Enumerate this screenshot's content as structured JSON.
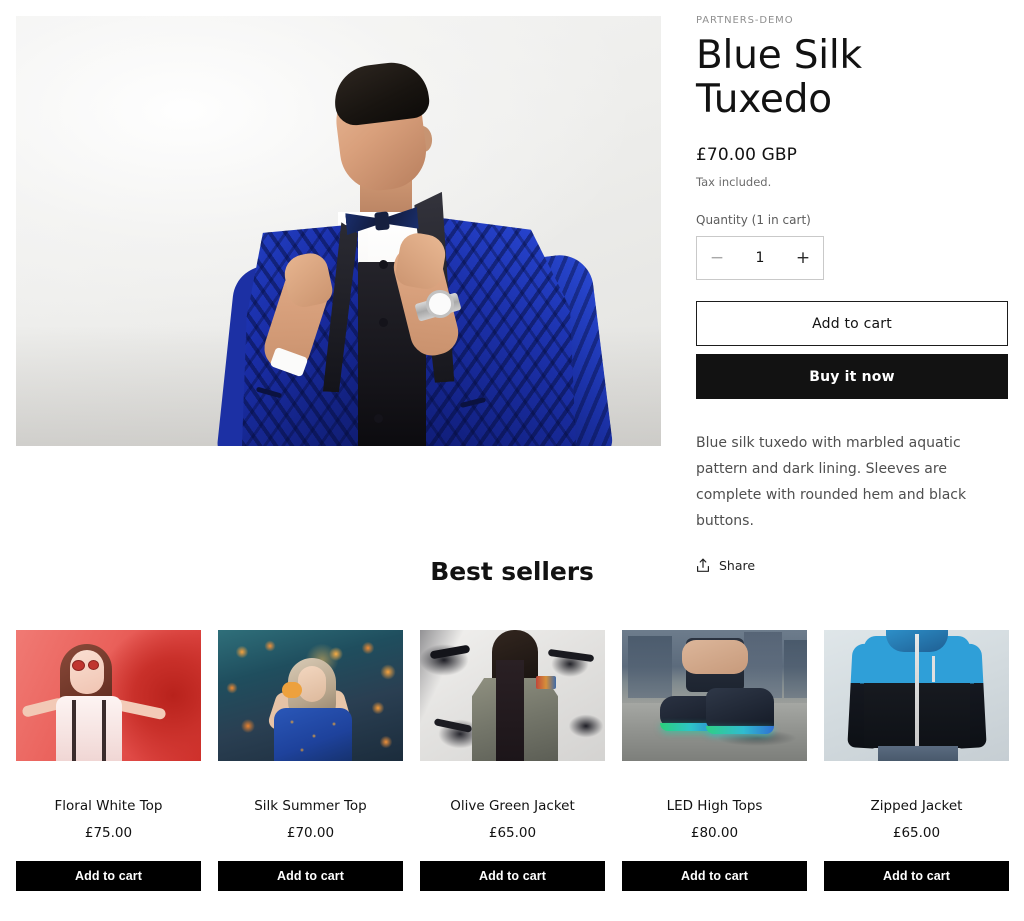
{
  "product": {
    "vendor": "PARTNERS-DEMO",
    "title": "Blue Silk Tuxedo",
    "price": "£70.00 GBP",
    "tax_note": "Tax included.",
    "quantity_label": "Quantity (1 in cart)",
    "quantity_value": "1",
    "decrease_symbol": "−",
    "increase_symbol": "+",
    "add_to_cart_label": "Add to cart",
    "buy_now_label": "Buy it now",
    "description": "Blue silk tuxedo with marbled aquatic pattern and dark lining. Sleeves are complete with rounded hem and black buttons.",
    "share_label": "Share",
    "share_icon": "share-upload-icon",
    "image_alt": "Man wearing a blue silk tuxedo jacket adjusting his bow tie"
  },
  "best_sellers": {
    "heading": "Best sellers",
    "items": [
      {
        "name": "Floral White Top",
        "price": "£75.00",
        "button_label": "Add to cart",
        "image_alt": "Woman in white floral top against a red backdrop"
      },
      {
        "name": "Silk Summer Top",
        "price": "£70.00",
        "button_label": "Add to cart",
        "image_alt": "Woman in blue patterned silk top at a carnival"
      },
      {
        "name": "Olive Green Jacket",
        "price": "£65.00",
        "button_label": "Add to cart",
        "image_alt": "Woman in an olive green jacket in front of a graffiti wall"
      },
      {
        "name": "LED High Tops",
        "price": "£80.00",
        "button_label": "Add to cart",
        "image_alt": "Person lacing up LED high top sneakers"
      },
      {
        "name": "Zipped Jacket",
        "price": "£65.00",
        "button_label": "Add to cart",
        "image_alt": "Blue and black zipped windbreaker jacket"
      }
    ]
  },
  "theme": {
    "accent_dark": "#121212",
    "button_black": "#000000",
    "text_muted": "#6b6b6b",
    "border_grey": "#c9c9c9",
    "page_background": "#ffffff"
  }
}
